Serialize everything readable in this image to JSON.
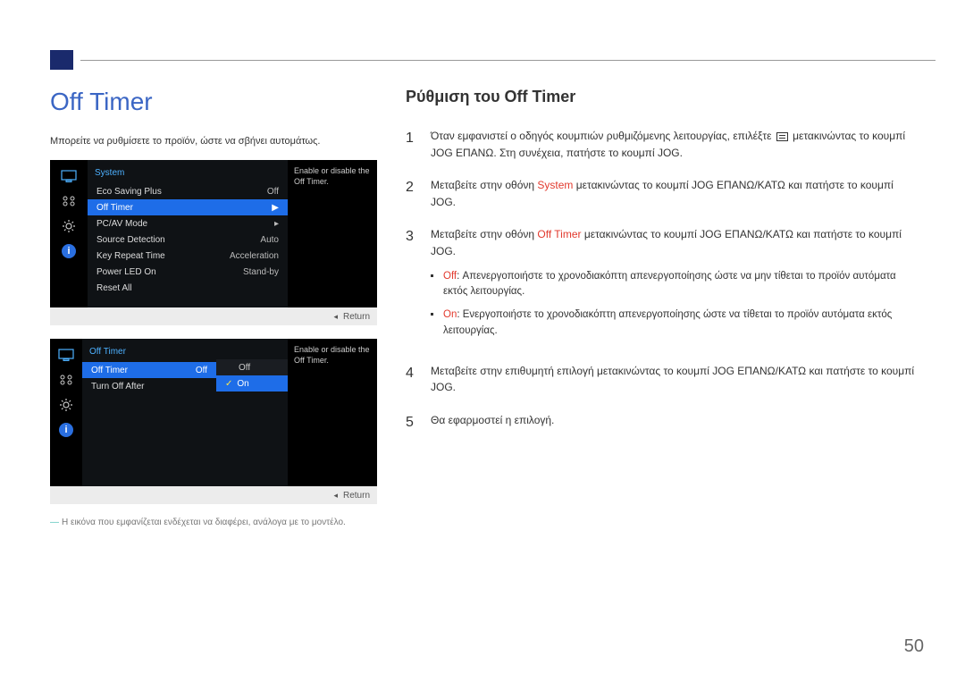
{
  "corner": {},
  "left": {
    "title": "Off Timer",
    "intro": "Μπορείτε να ρυθμίσετε το προϊόν, ώστε να σβήνει αυτομάτως.",
    "osd1": {
      "side_icons": [
        "monitor-icon",
        "picture-icon",
        "gear-icon",
        "info-icon"
      ],
      "header": "System",
      "rows": [
        {
          "label": "Eco Saving Plus",
          "value": "Off",
          "selected": false
        },
        {
          "label": "Off Timer",
          "value": "▶",
          "selected": true
        },
        {
          "label": "PC/AV Mode",
          "value": "▸",
          "selected": false
        },
        {
          "label": "Source Detection",
          "value": "Auto",
          "selected": false
        },
        {
          "label": "Key Repeat Time",
          "value": "Acceleration",
          "selected": false
        },
        {
          "label": "Power LED On",
          "value": "Stand-by",
          "selected": false
        },
        {
          "label": "Reset All",
          "value": "",
          "selected": false
        }
      ],
      "tip": "Enable or disable the Off Timer.",
      "footer": {
        "arrow": "◂",
        "label": "Return"
      }
    },
    "osd2": {
      "side_icons": [
        "monitor-icon",
        "picture-icon",
        "gear-icon",
        "info-icon"
      ],
      "header": "Off Timer",
      "rows": [
        {
          "label": "Off Timer",
          "value": "Off",
          "selected": true
        },
        {
          "label": "Turn Off After",
          "value": "",
          "selected": false
        }
      ],
      "dropdown": [
        {
          "label": "Off",
          "selected": false
        },
        {
          "label": "On",
          "selected": true
        }
      ],
      "tip": "Enable or disable the Off Timer.",
      "footer": {
        "arrow": "◂",
        "label": "Return"
      }
    },
    "footnote_dash": "―",
    "footnote": "Η εικόνα που εμφανίζεται ενδέχεται να διαφέρει, ανάλογα με το μοντέλο."
  },
  "right": {
    "subtitle": "Ρύθμιση του Off Timer",
    "steps": [
      {
        "num": "1",
        "pre": "Όταν εμφανιστεί ο οδηγός κουμπιών ρυθμιζόμενης λειτουργίας, επιλέξτε ",
        "post": " μετακινώντας το κουμπί JOG ΕΠΑΝΩ. Στη συνέχεια, πατήστε το κουμπί JOG."
      },
      {
        "num": "2",
        "text_a": "Μεταβείτε στην οθόνη ",
        "highlight": "System",
        "text_b": " μετακινώντας το κουμπί JOG ΕΠΑΝΩ/ΚΑΤΩ και πατήστε το κουμπί JOG."
      },
      {
        "num": "3",
        "text_a": "Μεταβείτε στην οθόνη ",
        "highlight": "Off Timer",
        "text_b": " μετακινώντας το κουμπί JOG ΕΠΑΝΩ/ΚΑΤΩ και πατήστε το κουμπί JOG.",
        "sub": [
          {
            "bold": "Off",
            "text": ": Απενεργοποιήστε το χρονοδιακόπτη απενεργοποίησης ώστε να μην τίθεται το προϊόν αυτόματα εκτός λειτουργίας."
          },
          {
            "bold": "On",
            "text": ": Ενεργοποιήστε το χρονοδιακόπτη απενεργοποίησης ώστε να τίθεται το προϊόν αυτόματα εκτός λειτουργίας."
          }
        ]
      },
      {
        "num": "4",
        "text": "Μεταβείτε στην επιθυμητή επιλογή μετακινώντας το κουμπί JOG ΕΠΑΝΩ/ΚΑΤΩ και πατήστε το κουμπί JOG."
      },
      {
        "num": "5",
        "text": "Θα εφαρμοστεί η επιλογή."
      }
    ]
  },
  "pagenum": "50"
}
